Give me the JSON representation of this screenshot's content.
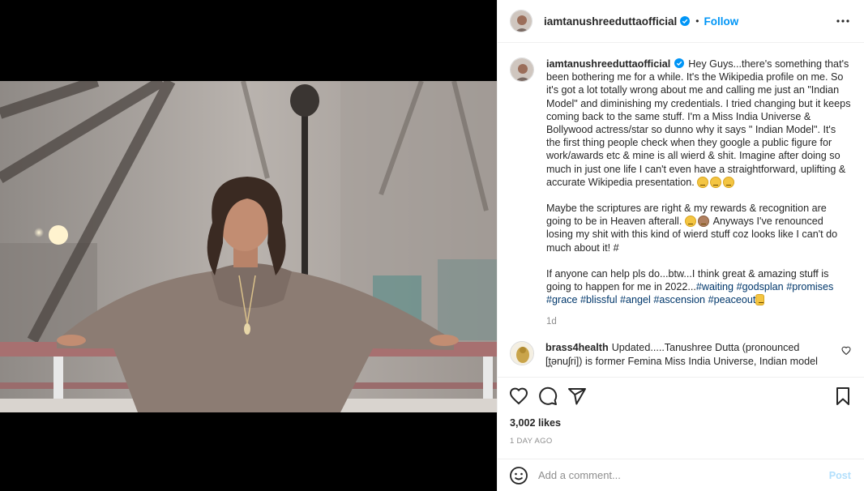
{
  "post": {
    "username": "iamtanushreeduttaofficial",
    "verified": true,
    "follow_label": "Follow",
    "more_icon": "more-horizontal-icon",
    "caption": {
      "paragraph1": "Hey Guys...there's something that's been bothering me for a while. It's the Wikipedia profile on me. So it's got a lot totally wrong about me and calling me just an \"Indian Model\" and diminishing my credentials. I tried changing but it keeps coming back to the same stuff. I'm a Miss India Universe & Bollywood actress/star so dunno why it says \" Indian Model\". It's the first thing people check when they google a public figure for work/awards etc & mine is all wierd & shit. Imagine after doing so much in just one life I can't even have a straightforward, uplifting & accurate Wikipedia presentation.",
      "paragraph2_a": "Maybe the scriptures are right & my rewards & recognition are going to be in Heaven afterall.",
      "paragraph2_b": "Anyways I've renounced losing my shit with this kind of wierd stuff coz looks like I can't do much about it! #",
      "paragraph3": "If anyone can help pls do...btw...I think great & amazing stuff is going to happen for me in 2022...",
      "hashtags": [
        "#waiting",
        "#godsplan",
        "#promises",
        "#grace",
        "#blissful",
        "#angel",
        "#ascension",
        "#peaceout"
      ],
      "time": "1d"
    },
    "comments": [
      {
        "username": "brass4health",
        "text": "Updated.....Tanushree Dutta (pronounced [t̪ənuʃri]) is former Femina Miss India Universe, Indian model"
      }
    ],
    "likes": "3,002 likes",
    "timestamp": "1 DAY AGO",
    "comment_placeholder": "Add a comment...",
    "post_label": "Post"
  },
  "colors": {
    "accent": "#0095f6",
    "post_disabled": "#b2dffc",
    "hashtag": "#00376b",
    "secondary_text": "#8e8e8e"
  }
}
